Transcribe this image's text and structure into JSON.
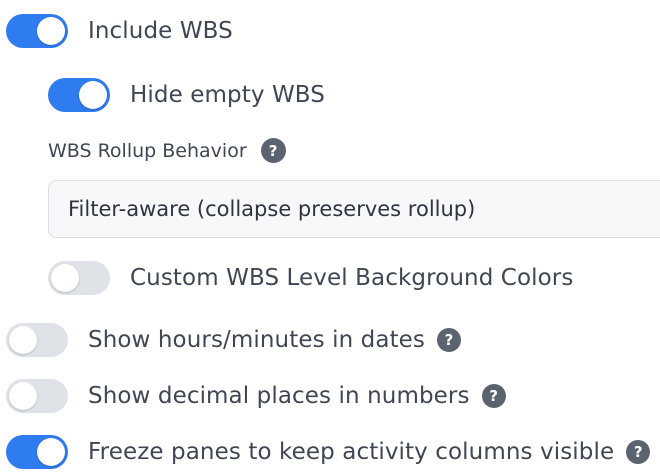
{
  "settings": {
    "include_wbs": {
      "label": "Include WBS",
      "enabled": true
    },
    "hide_empty_wbs": {
      "label": "Hide empty WBS",
      "enabled": true
    },
    "rollup": {
      "label": "WBS Rollup Behavior",
      "help_icon": "question-circle-icon",
      "selected": "Filter-aware (collapse preserves rollup)"
    },
    "custom_colors": {
      "label": "Custom WBS Level Background Colors",
      "enabled": false
    },
    "show_hours": {
      "label": "Show hours/minutes in dates",
      "enabled": false,
      "help_icon": "question-circle-icon"
    },
    "show_decimals": {
      "label": "Show decimal places in numbers",
      "enabled": false,
      "help_icon": "question-circle-icon"
    },
    "freeze_panes": {
      "label": "Freeze panes to keep activity columns visible",
      "enabled": true,
      "help_icon": "question-circle-icon"
    },
    "help_glyph": "?"
  },
  "colors": {
    "toggle_on": "#2f7bf0",
    "toggle_off": "#dfe2e7",
    "help_bg": "#5c6370",
    "text": "#3f4654"
  }
}
